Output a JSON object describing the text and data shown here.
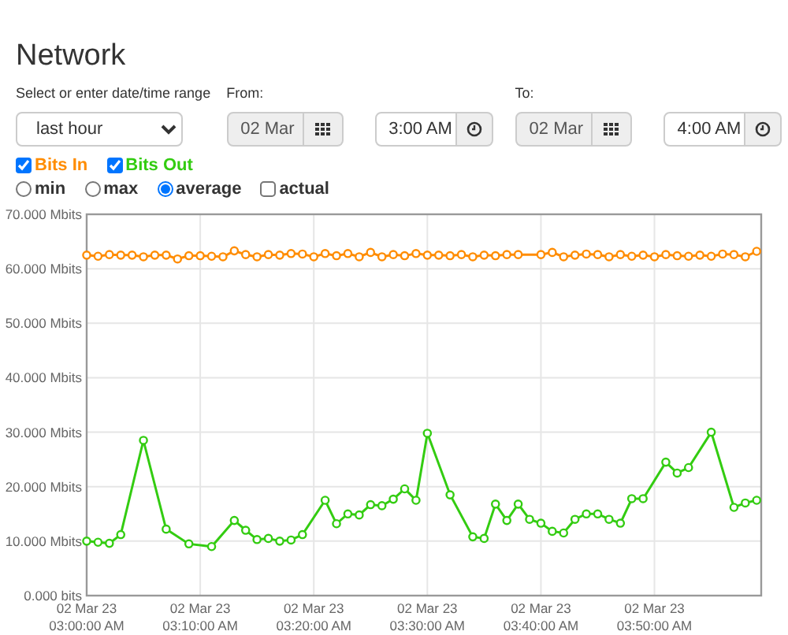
{
  "title": "Network",
  "range": {
    "label": "Select or enter date/time range",
    "value": "last hour"
  },
  "from": {
    "label": "From:",
    "date": "02 Mar",
    "time": "3:00 AM"
  },
  "to": {
    "label": "To:",
    "date": "02 Mar",
    "time": "4:00 AM"
  },
  "series_toggles": [
    {
      "checked": true
    },
    {
      "checked": true
    }
  ],
  "modes": [
    {
      "kind": "radio",
      "label": "min",
      "selected": false
    },
    {
      "kind": "radio",
      "label": "max",
      "selected": false
    },
    {
      "kind": "radio",
      "label": "average",
      "selected": true
    },
    {
      "kind": "checkbox",
      "label": "actual",
      "selected": false
    }
  ],
  "chart_data": {
    "type": "line",
    "categories": [
      "02 Mar 23 03:00:00 AM",
      null,
      null,
      null,
      null,
      null,
      null,
      null,
      null,
      null,
      "02 Mar 23 03:10:00 AM",
      null,
      null,
      null,
      null,
      null,
      null,
      null,
      null,
      null,
      "02 Mar 23 03:20:00 AM",
      null,
      null,
      null,
      null,
      null,
      null,
      null,
      null,
      null,
      "02 Mar 23 03:30:00 AM",
      null,
      null,
      null,
      null,
      null,
      null,
      null,
      null,
      null,
      "02 Mar 23 03:40:00 AM",
      null,
      null,
      null,
      null,
      null,
      null,
      null,
      null,
      null,
      "02 Mar 23 03:50:00 AM",
      null,
      null,
      null,
      null,
      null,
      null,
      null,
      null,
      null
    ],
    "grid": true,
    "ylim": [
      0,
      70
    ],
    "yticks": [
      {
        "value": 0,
        "label": "0.000 bits"
      },
      {
        "value": 10,
        "label": "10.000 Mbits"
      },
      {
        "value": 20,
        "label": "20.000 Mbits"
      },
      {
        "value": 30,
        "label": "30.000 Mbits"
      },
      {
        "value": 40,
        "label": "40.000 Mbits"
      },
      {
        "value": 50,
        "label": "50.000 Mbits"
      },
      {
        "value": 60,
        "label": "60.000 Mbits"
      },
      {
        "value": 70,
        "label": "70.000 Mbits"
      }
    ],
    "series": [
      {
        "name": "Bits In",
        "color": "#ff8c00",
        "marker": "circle",
        "values": [
          62.5,
          62.3,
          62.6,
          62.5,
          62.5,
          62.2,
          62.5,
          62.5,
          61.8,
          62.4,
          62.4,
          62.3,
          62.2,
          63.3,
          62.6,
          62.2,
          62.6,
          62.5,
          62.8,
          62.7,
          62.2,
          62.8,
          62.4,
          62.8,
          62.2,
          63.0,
          62.2,
          62.6,
          62.4,
          62.8,
          62.5,
          62.5,
          62.4,
          62.6,
          62.2,
          62.5,
          62.4,
          62.6,
          62.6,
          null,
          62.6,
          63.0,
          62.2,
          62.5,
          62.7,
          62.6,
          62.2,
          62.6,
          62.3,
          62.5,
          62.2,
          62.6,
          62.4,
          62.3,
          62.5,
          62.3,
          62.7,
          62.6,
          62.2,
          63.2
        ]
      },
      {
        "name": "Bits Out",
        "color": "#33cc11",
        "marker": "circle",
        "values": [
          10.0,
          9.8,
          9.6,
          11.2,
          null,
          28.5,
          null,
          12.2,
          null,
          9.5,
          null,
          9.0,
          null,
          13.8,
          12.0,
          10.3,
          10.5,
          10.0,
          10.2,
          11.2,
          null,
          17.5,
          13.2,
          15.0,
          14.8,
          16.7,
          16.5,
          17.7,
          19.6,
          17.5,
          29.8,
          null,
          18.5,
          null,
          10.8,
          10.5,
          16.8,
          13.8,
          16.8,
          14.0,
          13.3,
          11.8,
          11.5,
          14.0,
          15.0,
          15.0,
          14.0,
          13.3,
          17.8,
          17.8,
          null,
          24.5,
          22.5,
          23.5,
          null,
          30.0,
          null,
          16.2,
          17.0,
          17.5
        ]
      }
    ]
  }
}
